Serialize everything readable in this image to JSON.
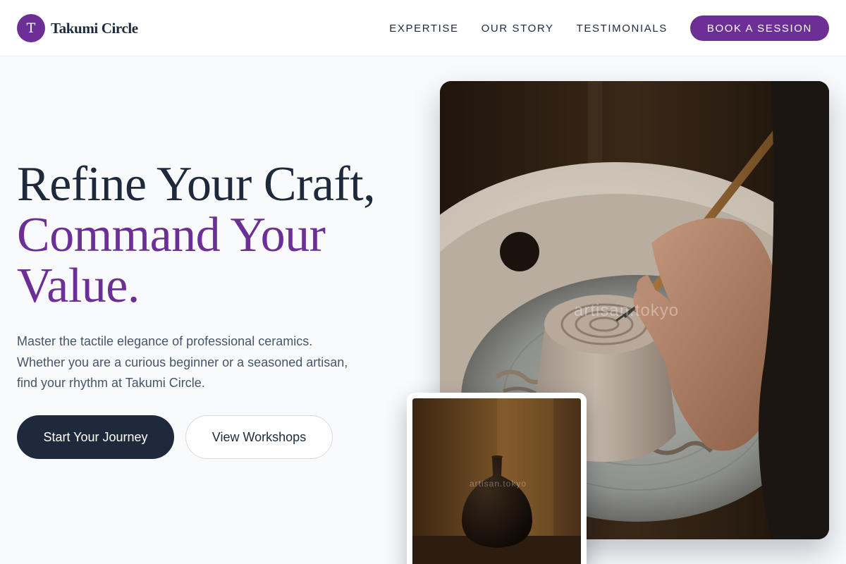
{
  "brand": {
    "initial": "T",
    "name": "Takumi Circle"
  },
  "nav": {
    "links": [
      "EXPERTISE",
      "OUR STORY",
      "TESTIMONIALS"
    ],
    "cta_label": "BOOK A SESSION"
  },
  "hero": {
    "title_line1": "Refine Your Craft,",
    "title_line2": "Command Your Value.",
    "description": "Master the tactile elegance of professional ceramics. Whether you are a curious beginner or a seasoned artisan, find your rhythm at Takumi Circle.",
    "primary_button": "Start Your Journey",
    "secondary_button": "View Workshops"
  },
  "images": {
    "main_watermark": "artisan.tokyo",
    "inset_watermark": "artisan.tokyo"
  },
  "colors": {
    "accent": "#6b2f96",
    "dark": "#1e293b",
    "body_text": "#475569",
    "background": "#f8fafc"
  }
}
